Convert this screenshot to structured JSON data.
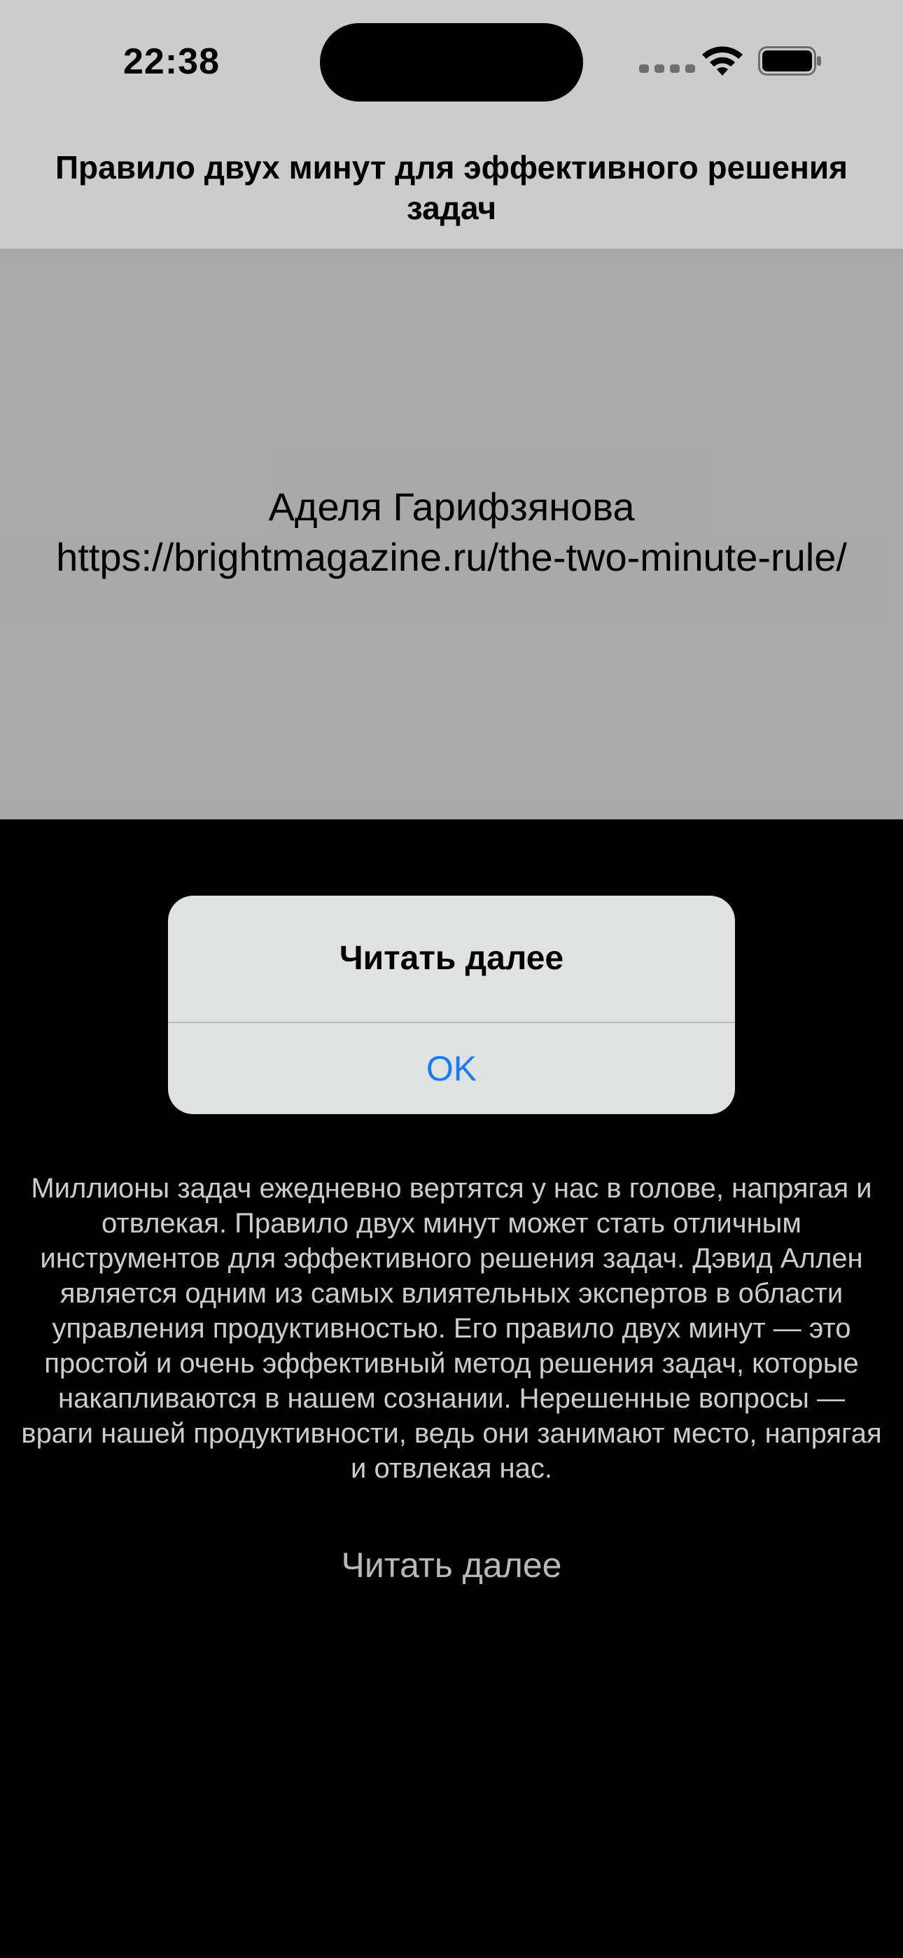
{
  "status_bar": {
    "time": "22:38"
  },
  "nav": {
    "title": "Правило двух минут для эффективного решения задач"
  },
  "hero": {
    "author": "Аделя Гарифзянова",
    "url": "https://brightmagazine.ru/the-two-minute-rule/"
  },
  "article": {
    "body": "Миллионы задач ежедневно вертятся у нас в голове, напрягая и отвлекая. Правило двух минут может стать отличным инструментов для эффективного решения задач. Дэвид Аллен является одним из самых влиятельных экспертов в области управления продуктивностью. Его правило двух минут — это простой и очень эффективный метод решения задач, которые накапливаются в нашем сознании. Нерешенные вопросы — враги нашей продуктивности, ведь они занимают место, напрягая и отвлекая нас.",
    "read_more_label": "Читать далее"
  },
  "alert": {
    "title": "Читать далее",
    "ok_label": "OK"
  },
  "colors": {
    "accent": "#1a7cf5",
    "alert_bg": "#e0e1e1"
  },
  "icons": [
    "cellular-signal-icon",
    "wifi-icon",
    "battery-icon"
  ]
}
